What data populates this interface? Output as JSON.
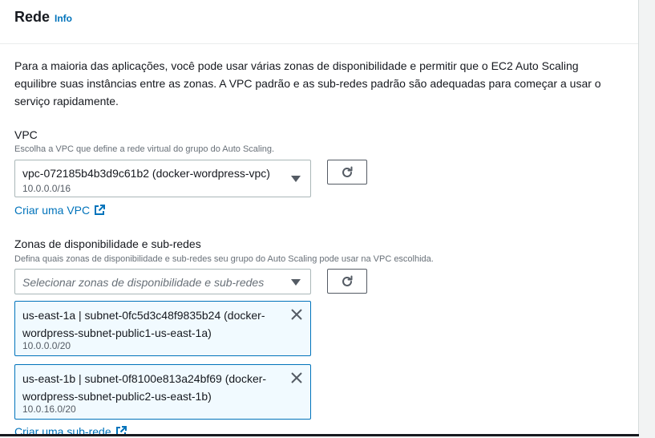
{
  "section": {
    "title": "Rede",
    "info_label": "Info"
  },
  "description": "Para a maioria das aplicações, você pode usar várias zonas de disponibilidade e permitir que o EC2 Auto Scaling equilibre suas instâncias entre as zonas. A VPC padrão e as sub-redes padrão são adequadas para começar a usar o serviço rapidamente.",
  "vpc": {
    "label": "VPC",
    "hint": "Escolha a VPC que define a rede virtual do grupo do Auto Scaling.",
    "selected": "vpc-072185b4b3d9c61b2 (docker-wordpress-vpc)",
    "selected_cidr": "10.0.0.0/16",
    "create_link": "Criar uma VPC"
  },
  "zones": {
    "label": "Zonas de disponibilidade e sub-redes",
    "hint": "Defina quais zonas de disponibilidade e sub-redes seu grupo do Auto Scaling pode usar na VPC escolhida.",
    "placeholder": "Selecionar zonas de disponibilidade e sub-redes",
    "tokens": [
      {
        "line1": "us-east-1a | subnet-0fc5d3c48f9835b24 (docker-",
        "line2": "wordpress-subnet-public1-us-east-1a)",
        "cidr": "10.0.0.0/20"
      },
      {
        "line1": "us-east-1b | subnet-0f8100e813a24bf69 (docker-",
        "line2": "wordpress-subnet-public2-us-east-1b)",
        "cidr": "10.0.16.0/20"
      }
    ],
    "create_link": "Criar uma sub-rede"
  },
  "colors": {
    "link": "#0073bb",
    "token_bg": "#f1faff",
    "token_border": "#0073bb"
  },
  "icons": {
    "refresh": "refresh-icon",
    "external": "external-link-icon",
    "remove": "close-icon",
    "dropdown": "caret-down-icon"
  }
}
